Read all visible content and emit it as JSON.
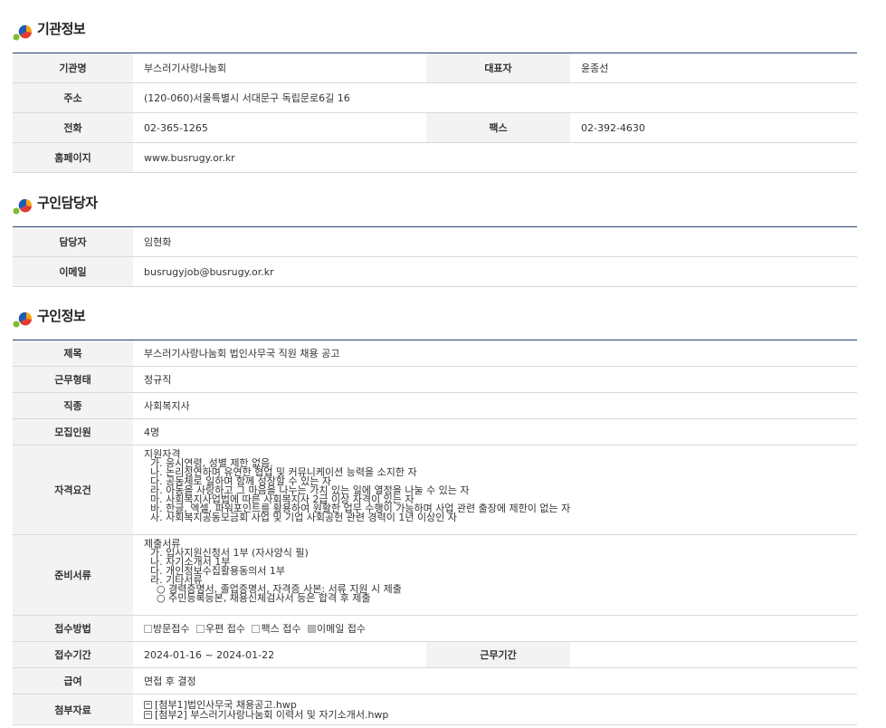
{
  "org": {
    "title": "기관정보",
    "rows": [
      {
        "label": "기관명",
        "value": "부스러기사랑나눔회",
        "label2": "대표자",
        "value2": "윤종선"
      },
      {
        "label": "주소",
        "value": "(120-060)서울특별시 서대문구 독립문로6길 16"
      },
      {
        "label": "전화",
        "value": "02-365-1265",
        "label2": "팩스",
        "value2": "02-392-4630"
      },
      {
        "label": "홈페이지",
        "value": "www.busrugy.or.kr"
      }
    ]
  },
  "contact": {
    "title": "구인담당자",
    "rows": [
      {
        "label": "담당자",
        "value": "임현화"
      },
      {
        "label": "이메일",
        "value": "busrugyjob@busrugy.or.kr"
      }
    ]
  },
  "job": {
    "title": "구인정보",
    "subject_label": "제목",
    "subject": "부스러기사랑나눔회 법인사무국 직원 채용 공고",
    "type_label": "근무형태",
    "type": "정규직",
    "category_label": "직종",
    "category": "사회복지사",
    "headcount_label": "모집인원",
    "headcount": "4명",
    "qualification_label": "자격요건",
    "qualification": "지원자격\n  가. 응시연령, 성별 제한 없음.\n  나. 논리정연하며 유연한 협업 및 커뮤니케이션 능력을 소지한 자\n  다. 공동체로 일하며 함께 성장할 수 있는 자\n  라. 아동을 사랑하고 그 마음을 나누는 가치 있는 일에 열정을 나눌 수 있는 자\n  마. 사회복지사업법에 따른 사회복지사 2급 이상 자격이 있는 자\n  바. 한글, 엑셀, 파워포인트를 활용하여 원활한 업무 수행이 가능하며 사업 관련 출장에 제한이 없는 자\n  사. 사회복지공동모금회 사업 및 기업 사회공헌 관련 경력이 1년 이상인 자",
    "documents_label": "준비서류",
    "documents": "제출서류\n  가. 입사지원신청서 1부 (자사양식 필)\n  나. 자기소개서 1부\n  다. 개인정보수집활용동의서 1부\n  라. 기타서류\n    ○ 경력증명서, 졸업증명서, 자격증 사본: 서류 지원 시 제출\n    ○ 주민등록등본, 채용신체검사서 등은 합격 후 제출",
    "method_label": "접수방법",
    "methods": [
      {
        "label": "방문접수",
        "checked": false
      },
      {
        "label": "우편 접수",
        "checked": false
      },
      {
        "label": "팩스 접수",
        "checked": false
      },
      {
        "label": "이메일 접수",
        "checked": true
      }
    ],
    "period_label": "접수기간",
    "period": "2024-01-16 ~ 2024-01-22",
    "work_period_label": "근무기간",
    "work_period": "",
    "salary_label": "급여",
    "salary": "면접 후 결정",
    "attach_label": "첨부자료",
    "attachments": [
      "[첨부1]법인사무국 채용공고.hwp",
      "[첨부2] 부스러기사랑나눔회  이력서 및 자기소개서.hwp"
    ]
  }
}
